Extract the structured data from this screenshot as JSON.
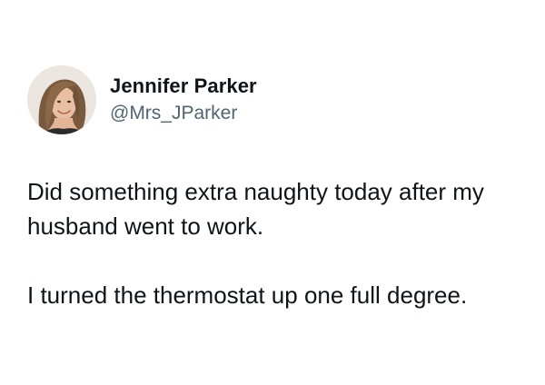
{
  "author": {
    "display_name": "Jennifer Parker",
    "handle": "@Mrs_JParker",
    "avatar_icon": "profile-photo"
  },
  "tweet": {
    "paragraphs": [
      "Did something extra naughty today after my husband went to work.",
      "I turned the thermostat up one full degree."
    ]
  },
  "colors": {
    "background": "#ffffff",
    "text_primary": "#0f1419",
    "text_secondary": "#536471"
  }
}
